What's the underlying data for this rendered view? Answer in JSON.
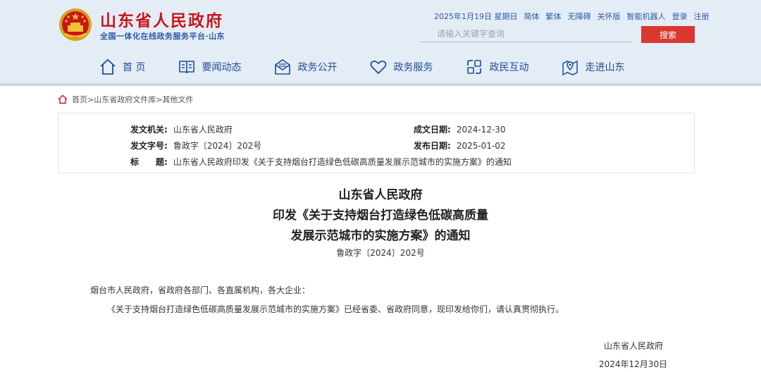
{
  "header": {
    "site_title": "山东省人民政府",
    "site_subtitle": "全国一体化在线政务服务平台·山东",
    "emblem_icon": "national-emblem-icon",
    "utility_links": [
      "2025年1月19日 星期日",
      "简体",
      "繁体",
      "无障碍",
      "关怀版",
      "智能机器人",
      "登录",
      "注册"
    ],
    "search": {
      "placeholder": "请输入关键字查询",
      "value": "",
      "button_label": "搜索"
    },
    "colors": {
      "brand_red": "#c8161d",
      "nav_blue": "#1f4f96",
      "header_bg": "#e4ecf6",
      "search_button": "#d9372f"
    }
  },
  "nav": {
    "items": [
      {
        "label": "首 页",
        "icon": "home-icon"
      },
      {
        "label": "要闻动态",
        "icon": "news-icon"
      },
      {
        "label": "政务公开",
        "icon": "mail-icon"
      },
      {
        "label": "政务服务",
        "icon": "heart-icon"
      },
      {
        "label": "政民互动",
        "icon": "interaction-icon"
      },
      {
        "label": "走进山东",
        "icon": "location-icon"
      }
    ]
  },
  "breadcrumb": {
    "icon": "home-icon",
    "text": "首页>山东省政府文件库>其他文件"
  },
  "meta": {
    "issuer_label": "发文机关:",
    "issuer_value": "山东省人民政府",
    "created_label": "成文日期:",
    "created_value": "2024-12-30",
    "doc_no_label": "发文字号:",
    "doc_no_value": "鲁政字〔2024〕202号",
    "published_label": "发布日期:",
    "published_value": "2025-01-02",
    "title_label": "标　　题:",
    "title_value": "山东省人民政府印发《关于支持烟台打造绿色低碳高质量发展示范城市的实施方案》的通知"
  },
  "document": {
    "title_line1": "山东省人民政府",
    "title_line2": "印发《关于支持烟台打造绿色低碳高质量",
    "title_line3": "发展示范城市的实施方案》的通知",
    "doc_number": "鲁政字〔2024〕202号",
    "salutation": "烟台市人民政府，省政府各部门、各直属机构，各大企业：",
    "paragraph": "《关于支持烟台打造绿色低碳高质量发展示范城市的实施方案》已经省委、省政府同意，现印发给你们，请认真贯彻执行。",
    "signature": "山东省人民政府",
    "date": "2024年12月30日"
  }
}
